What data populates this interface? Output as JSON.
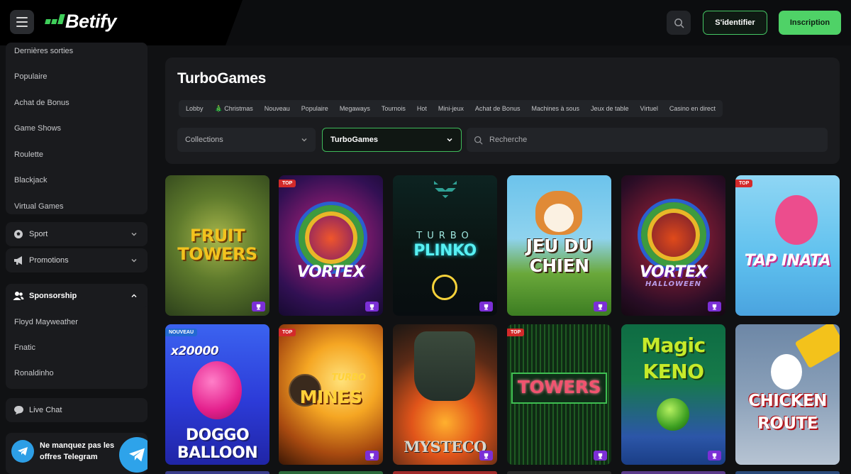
{
  "header": {
    "brand": "Betify",
    "login_label": "S'identifier",
    "signup_label": "Inscription"
  },
  "sidebar": {
    "casino_items": [
      "Dernières sorties",
      "Populaire",
      "Achat de Bonus",
      "Game Shows",
      "Roulette",
      "Blackjack",
      "Virtual Games"
    ],
    "sport_label": "Sport",
    "promotions_label": "Promotions",
    "sponsorship_label": "Sponsorship",
    "sponsorship_items": [
      "Floyd Mayweather",
      "Fnatic",
      "Ronaldinho"
    ],
    "live_chat_label": "Live Chat",
    "telegram_text": "Ne manquez pas les offres Telegram"
  },
  "panel": {
    "title": "TurboGames",
    "tabs": [
      "Lobby",
      "🎄 Christmas",
      "Nouveau",
      "Populaire",
      "Megaways",
      "Tournois",
      "Hot",
      "Mini-jeux",
      "Achat de Bonus",
      "Machines à sous",
      "Jeux de table",
      "Virtuel",
      "Casino en direct"
    ],
    "collections_label": "Collections",
    "provider_selected": "TurboGames",
    "search_placeholder": "Recherche"
  },
  "games": [
    {
      "title": "FRUIT TOWERS",
      "badge": "",
      "trophy": true
    },
    {
      "title": "VORTEX",
      "badge": "TOP",
      "trophy": true
    },
    {
      "title": "TURBO PLINKO",
      "badge": "",
      "trophy": true
    },
    {
      "title": "JEU DU CHIEN",
      "badge": "",
      "trophy": true
    },
    {
      "title": "VORTEX HALLOWEEN",
      "badge": "",
      "trophy": true
    },
    {
      "title": "TAP INATA",
      "badge": "TOP",
      "trophy": false
    },
    {
      "title": "DOGGO BALLOON",
      "badge": "NOUVEAU",
      "trophy": false,
      "subtitle": "x20000"
    },
    {
      "title": "TURBO MINES",
      "badge": "TOP",
      "trophy": true
    },
    {
      "title": "MYSTECO",
      "badge": "",
      "trophy": true
    },
    {
      "title": "TOWERS",
      "badge": "TOP",
      "trophy": true
    },
    {
      "title": "MAGIC KENO",
      "badge": "",
      "trophy": true
    },
    {
      "title": "CHICKEN ROUTE",
      "badge": "",
      "trophy": false
    }
  ],
  "colors": {
    "accent_green": "#4fd267",
    "badge_red": "#d32a2a",
    "badge_blue": "#2369d1",
    "trophy_purple": "#7b2fd6"
  }
}
